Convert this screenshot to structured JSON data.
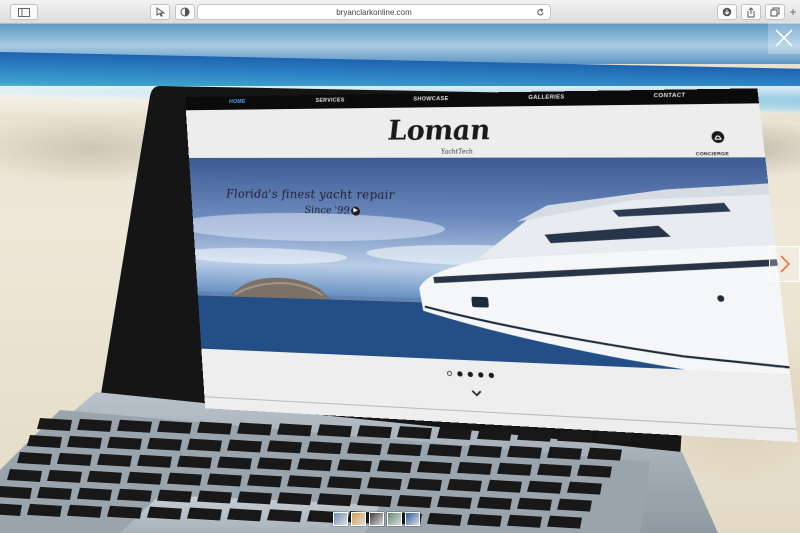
{
  "browser": {
    "url": "bryanclarkonline.com"
  },
  "site": {
    "nav": [
      "HOME",
      "SERVICES",
      "SHOWCASE",
      "GALLERIES",
      "CONTACT"
    ],
    "logo": "Loman",
    "logo_sub": "YachtTech",
    "concierge": "CONCIERGE",
    "tagline": "Florida's finest yacht repair",
    "since": "Since '99",
    "slides_total": 5,
    "slide_active": 1
  },
  "gallery": {
    "thumbnails": 5,
    "icons": [
      "close-icon",
      "next-arrow-icon"
    ]
  },
  "colors": {
    "nav_active": "#5aa8ff",
    "sea": "#2f86c6"
  }
}
